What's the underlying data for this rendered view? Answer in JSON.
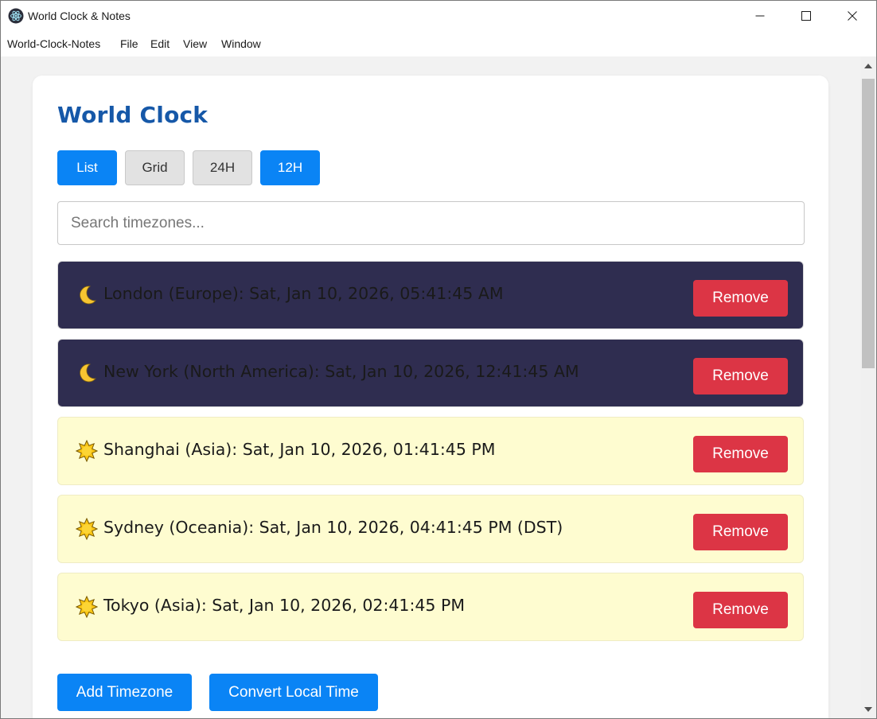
{
  "window": {
    "title": "World Clock & Notes"
  },
  "menu": [
    "World-Clock-Notes",
    "File",
    "Edit",
    "View",
    "Window"
  ],
  "main": {
    "heading": "World Clock",
    "view_buttons": [
      {
        "label": "List",
        "active": true
      },
      {
        "label": "Grid",
        "active": false
      },
      {
        "label": "24H",
        "active": false
      },
      {
        "label": "12H",
        "active": true
      }
    ],
    "search_placeholder": "Search timezones...",
    "timezones": [
      {
        "icon": "moon-icon",
        "text": "London (Europe): Sat, Jan 10, 2026, 05:41:45 AM",
        "mode": "night"
      },
      {
        "icon": "moon-icon",
        "text": "New York (North America): Sat, Jan 10, 2026, 12:41:45 AM",
        "mode": "night"
      },
      {
        "icon": "sun-icon",
        "text": "Shanghai (Asia): Sat, Jan 10, 2026, 01:41:45 PM",
        "mode": "day"
      },
      {
        "icon": "sun-icon",
        "text": "Sydney (Oceania): Sat, Jan 10, 2026, 04:41:45 PM (DST)",
        "mode": "day"
      },
      {
        "icon": "sun-icon",
        "text": "Tokyo (Asia): Sat, Jan 10, 2026, 02:41:45 PM",
        "mode": "day"
      }
    ],
    "remove_label": "Remove",
    "add_timezone_label": "Add Timezone",
    "convert_label": "Convert Local Time"
  },
  "colors": {
    "accent": "#0a84f5",
    "heading": "#1658a8",
    "night_row": "#2f2d50",
    "day_row": "#fefcd0",
    "remove": "#dc3545"
  }
}
